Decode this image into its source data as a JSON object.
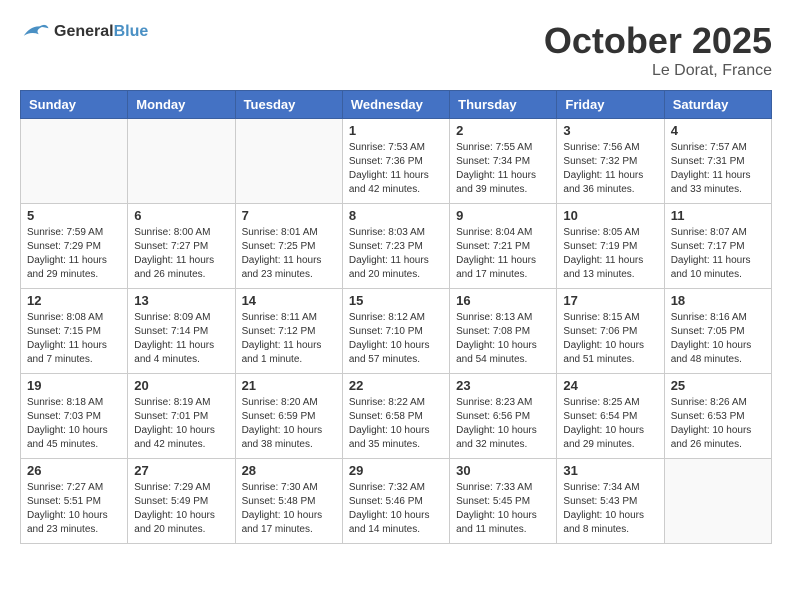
{
  "header": {
    "logo_text_general": "General",
    "logo_text_blue": "Blue",
    "month": "October 2025",
    "location": "Le Dorat, France"
  },
  "days_of_week": [
    "Sunday",
    "Monday",
    "Tuesday",
    "Wednesday",
    "Thursday",
    "Friday",
    "Saturday"
  ],
  "weeks": [
    [
      {
        "day": "",
        "info": ""
      },
      {
        "day": "",
        "info": ""
      },
      {
        "day": "",
        "info": ""
      },
      {
        "day": "1",
        "info": "Sunrise: 7:53 AM\nSunset: 7:36 PM\nDaylight: 11 hours and 42 minutes."
      },
      {
        "day": "2",
        "info": "Sunrise: 7:55 AM\nSunset: 7:34 PM\nDaylight: 11 hours and 39 minutes."
      },
      {
        "day": "3",
        "info": "Sunrise: 7:56 AM\nSunset: 7:32 PM\nDaylight: 11 hours and 36 minutes."
      },
      {
        "day": "4",
        "info": "Sunrise: 7:57 AM\nSunset: 7:31 PM\nDaylight: 11 hours and 33 minutes."
      }
    ],
    [
      {
        "day": "5",
        "info": "Sunrise: 7:59 AM\nSunset: 7:29 PM\nDaylight: 11 hours and 29 minutes."
      },
      {
        "day": "6",
        "info": "Sunrise: 8:00 AM\nSunset: 7:27 PM\nDaylight: 11 hours and 26 minutes."
      },
      {
        "day": "7",
        "info": "Sunrise: 8:01 AM\nSunset: 7:25 PM\nDaylight: 11 hours and 23 minutes."
      },
      {
        "day": "8",
        "info": "Sunrise: 8:03 AM\nSunset: 7:23 PM\nDaylight: 11 hours and 20 minutes."
      },
      {
        "day": "9",
        "info": "Sunrise: 8:04 AM\nSunset: 7:21 PM\nDaylight: 11 hours and 17 minutes."
      },
      {
        "day": "10",
        "info": "Sunrise: 8:05 AM\nSunset: 7:19 PM\nDaylight: 11 hours and 13 minutes."
      },
      {
        "day": "11",
        "info": "Sunrise: 8:07 AM\nSunset: 7:17 PM\nDaylight: 11 hours and 10 minutes."
      }
    ],
    [
      {
        "day": "12",
        "info": "Sunrise: 8:08 AM\nSunset: 7:15 PM\nDaylight: 11 hours and 7 minutes."
      },
      {
        "day": "13",
        "info": "Sunrise: 8:09 AM\nSunset: 7:14 PM\nDaylight: 11 hours and 4 minutes."
      },
      {
        "day": "14",
        "info": "Sunrise: 8:11 AM\nSunset: 7:12 PM\nDaylight: 11 hours and 1 minute."
      },
      {
        "day": "15",
        "info": "Sunrise: 8:12 AM\nSunset: 7:10 PM\nDaylight: 10 hours and 57 minutes."
      },
      {
        "day": "16",
        "info": "Sunrise: 8:13 AM\nSunset: 7:08 PM\nDaylight: 10 hours and 54 minutes."
      },
      {
        "day": "17",
        "info": "Sunrise: 8:15 AM\nSunset: 7:06 PM\nDaylight: 10 hours and 51 minutes."
      },
      {
        "day": "18",
        "info": "Sunrise: 8:16 AM\nSunset: 7:05 PM\nDaylight: 10 hours and 48 minutes."
      }
    ],
    [
      {
        "day": "19",
        "info": "Sunrise: 8:18 AM\nSunset: 7:03 PM\nDaylight: 10 hours and 45 minutes."
      },
      {
        "day": "20",
        "info": "Sunrise: 8:19 AM\nSunset: 7:01 PM\nDaylight: 10 hours and 42 minutes."
      },
      {
        "day": "21",
        "info": "Sunrise: 8:20 AM\nSunset: 6:59 PM\nDaylight: 10 hours and 38 minutes."
      },
      {
        "day": "22",
        "info": "Sunrise: 8:22 AM\nSunset: 6:58 PM\nDaylight: 10 hours and 35 minutes."
      },
      {
        "day": "23",
        "info": "Sunrise: 8:23 AM\nSunset: 6:56 PM\nDaylight: 10 hours and 32 minutes."
      },
      {
        "day": "24",
        "info": "Sunrise: 8:25 AM\nSunset: 6:54 PM\nDaylight: 10 hours and 29 minutes."
      },
      {
        "day": "25",
        "info": "Sunrise: 8:26 AM\nSunset: 6:53 PM\nDaylight: 10 hours and 26 minutes."
      }
    ],
    [
      {
        "day": "26",
        "info": "Sunrise: 7:27 AM\nSunset: 5:51 PM\nDaylight: 10 hours and 23 minutes."
      },
      {
        "day": "27",
        "info": "Sunrise: 7:29 AM\nSunset: 5:49 PM\nDaylight: 10 hours and 20 minutes."
      },
      {
        "day": "28",
        "info": "Sunrise: 7:30 AM\nSunset: 5:48 PM\nDaylight: 10 hours and 17 minutes."
      },
      {
        "day": "29",
        "info": "Sunrise: 7:32 AM\nSunset: 5:46 PM\nDaylight: 10 hours and 14 minutes."
      },
      {
        "day": "30",
        "info": "Sunrise: 7:33 AM\nSunset: 5:45 PM\nDaylight: 10 hours and 11 minutes."
      },
      {
        "day": "31",
        "info": "Sunrise: 7:34 AM\nSunset: 5:43 PM\nDaylight: 10 hours and 8 minutes."
      },
      {
        "day": "",
        "info": ""
      }
    ]
  ]
}
